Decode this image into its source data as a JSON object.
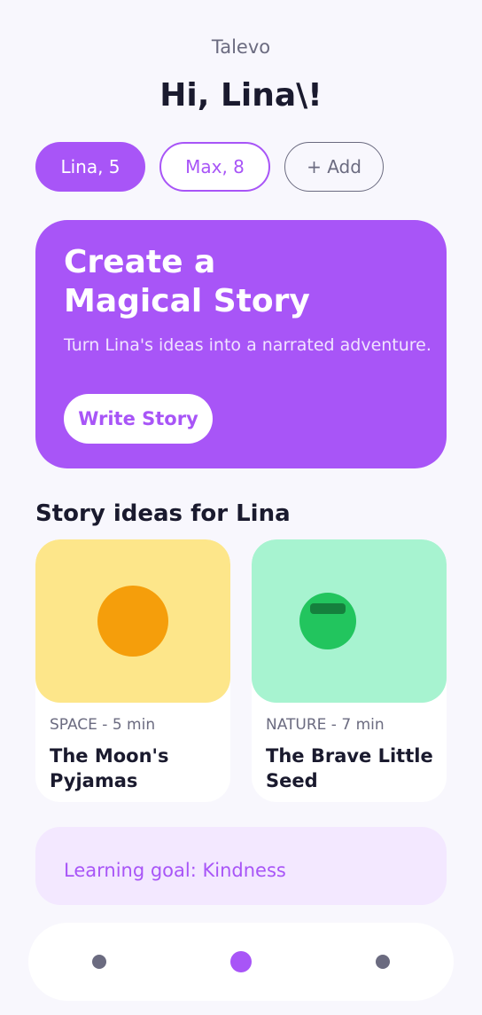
{
  "header": {
    "app_name": "Talevo",
    "greeting": "Hi, Lina\\!"
  },
  "profiles": [
    {
      "label": "Lina, 5"
    },
    {
      "label": "Max, 8"
    },
    {
      "label": "+ Add"
    }
  ],
  "hero": {
    "title": "Create a Magical Story",
    "subtitle": "Turn Lina's ideas into a narrated adventure.",
    "button_label": "Write Story"
  },
  "ideas": {
    "section_title": "Story ideas for Lina",
    "cards": [
      {
        "meta": "SPACE - 5 min",
        "title": "The Moon's Pyjamas",
        "icon": "moon-icon"
      },
      {
        "meta": "NATURE - 7 min",
        "title": "The Brave Little Seed",
        "icon": "seed-icon"
      }
    ]
  },
  "goal": {
    "text": "Learning goal: Kindness"
  },
  "nav": {
    "items": [
      "nav-left",
      "nav-center",
      "nav-right"
    ],
    "active_index": 1
  },
  "colors": {
    "accent": "#a855f7",
    "background": "#f8f7fd",
    "card1_art": "#fde68a",
    "card2_art": "#a7f3d0",
    "moon": "#f59e0b",
    "seed": "#22c55e",
    "goal_bg": "#f3e8ff"
  }
}
